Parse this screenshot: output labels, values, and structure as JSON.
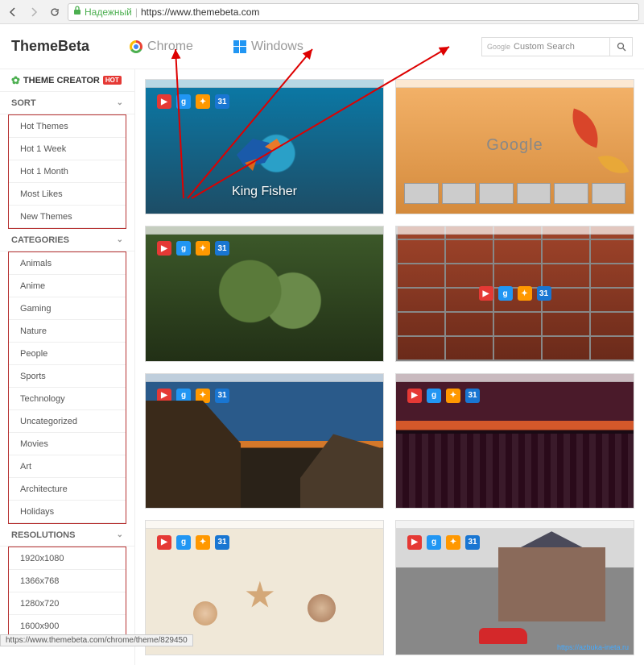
{
  "browser": {
    "secure_label": "Надежный",
    "url": "https://www.themebeta.com"
  },
  "header": {
    "logo": "ThemeBeta",
    "nav_chrome": "Chrome",
    "nav_windows": "Windows",
    "search_brand": "Google",
    "search_placeholder": "Custom Search"
  },
  "sidebar": {
    "theme_creator": "THEME CREATOR",
    "hot_badge": "HOT",
    "sort_header": "SORT",
    "sort_items": [
      "Hot Themes",
      "Hot 1 Week",
      "Hot 1 Month",
      "Most Likes",
      "New Themes"
    ],
    "categories_header": "CATEGORIES",
    "category_items": [
      "Animals",
      "Anime",
      "Gaming",
      "Nature",
      "People",
      "Sports",
      "Technology",
      "Uncategorized",
      "Movies",
      "Art",
      "Architecture",
      "Holidays"
    ],
    "resolutions_header": "RESOLUTIONS",
    "resolution_items": [
      "1920x1080",
      "1366x768",
      "1280x720",
      "1600x900"
    ]
  },
  "themes": [
    {
      "title": "King Fisher"
    },
    {
      "title": ""
    },
    {
      "title": ""
    },
    {
      "title": ""
    },
    {
      "title": ""
    },
    {
      "title": ""
    },
    {
      "title": ""
    },
    {
      "title": ""
    }
  ],
  "google_logo": "Google",
  "watermark": "https://azbuka-ineta.ru",
  "status_url": "https://www.themebeta.com/chrome/theme/829450"
}
